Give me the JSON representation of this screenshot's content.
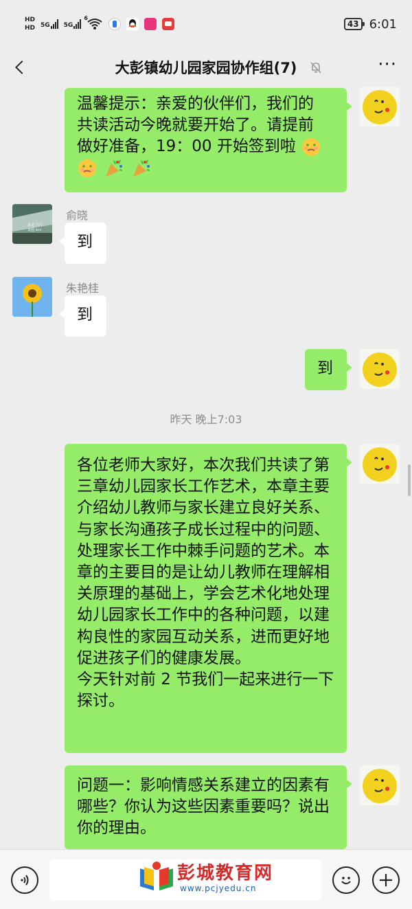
{
  "status_bar": {
    "hd1": "HD",
    "hd2": "HD",
    "net1": "5G",
    "net2": "5G",
    "wifi_badge": "6",
    "battery": "43",
    "time": "6:01"
  },
  "header": {
    "title": "大彭镇幼儿园家园协作组(7)",
    "more": "···"
  },
  "messages": [
    {
      "side": "self",
      "text_line1": "温馨提示：亲爱的伙伴们，我们的",
      "text_line2": "共读活动今晚就要开始了。请提前",
      "text_line3": "做好准备，19：00 开始签到啦"
    },
    {
      "side": "other",
      "sender": "俞晓",
      "text": "到"
    },
    {
      "side": "other",
      "sender": "朱艳桂",
      "text": "到"
    },
    {
      "side": "self",
      "text": "到"
    },
    {
      "type": "timestamp",
      "text": "昨天 晚上7:03"
    },
    {
      "side": "self",
      "text": "各位老师大家好，本次我们共读了第三章幼儿园家长工作艺术，本章主要介绍幼儿教师与家长建立良好关系、与家长沟通孩子成长过程中的问题、处理家长工作中棘手问题的艺术。本章的主要目的是让幼儿教师在理解相关原理的基础上，学会艺术化地处理幼儿园家长工作中的各种问题，以建构良性的家园互动关系，进而更好地促进孩子们的健康发展。",
      "text_extra": "今天针对前 2 节我们一起来进行一下探讨。"
    },
    {
      "side": "self",
      "text": "问题一：影响情感关系建立的因素有哪些？你认为这些因素重要吗？说出你的理由。"
    }
  ],
  "avatar_text": "承诺 只行 太固 wrz",
  "watermark": {
    "title": "彭城教育网",
    "url": "www.pcjyedu.cn"
  },
  "colors": {
    "green_bubble": "#95ec69",
    "background": "#ededed"
  }
}
